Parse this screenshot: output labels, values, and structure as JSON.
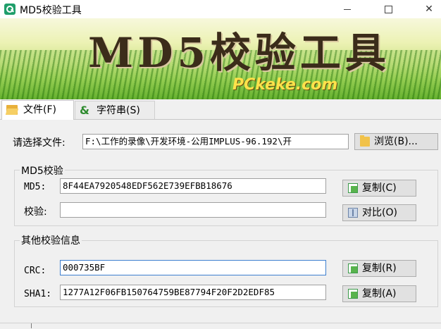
{
  "window": {
    "title": "MD5校验工具"
  },
  "banner": {
    "title": "MD5校验工具",
    "subtitle": "PCkeke.com"
  },
  "tabs": [
    {
      "label": "文件(F)",
      "icon": "open-folder-icon"
    },
    {
      "label": "字符串(S)",
      "icon": "ampersand-icon"
    }
  ],
  "file": {
    "label": "请选择文件:",
    "path": "F:\\工作的录像\\开发环境-公用IMPLUS-96.192\\开",
    "browse_label": "浏览(B)..."
  },
  "md5_group": {
    "title": "MD5校验",
    "md5_label": "MD5:",
    "md5_value": "8F44EA7920548EDF562E739EFBB18676",
    "copy_label": "复制(C)",
    "verify_label": "校验:",
    "verify_value": "",
    "compare_label": "对比(O)"
  },
  "other_group": {
    "title": "其他校验信息",
    "crc_label": "CRC:",
    "crc_value": "000735BF",
    "crc_copy_label": "复制(R)",
    "sha1_label": "SHA1:",
    "sha1_value": "1277A12F06FB150764759BE87794F20F2D2EDF85",
    "sha1_copy_label": "复制(A)"
  }
}
